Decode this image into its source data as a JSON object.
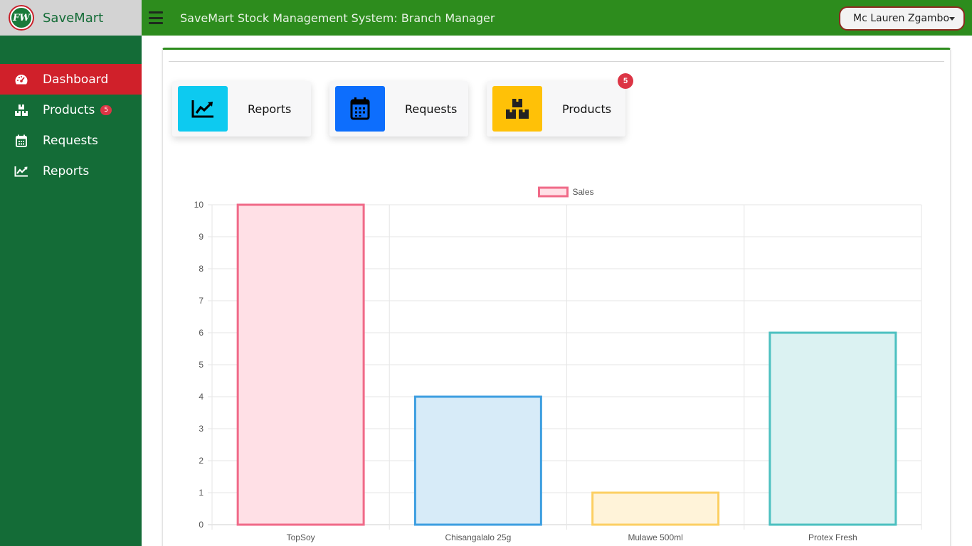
{
  "brand": {
    "name": "SaveMart",
    "logo_text": "FW"
  },
  "sidebar": {
    "items": [
      {
        "label": "Dashboard",
        "icon": "dashboard-icon",
        "active": true
      },
      {
        "label": "Products",
        "icon": "boxes-icon",
        "badge": "5"
      },
      {
        "label": "Requests",
        "icon": "calendar-icon"
      },
      {
        "label": "Reports",
        "icon": "chart-line-icon"
      }
    ]
  },
  "topbar": {
    "title": "SaveMart Stock Management System: Branch Manager",
    "user": "Mc Lauren Zgambo"
  },
  "tiles": [
    {
      "label": "Reports",
      "icon": "chart-line-icon",
      "color": "#0dcaf0"
    },
    {
      "label": "Requests",
      "icon": "calendar-icon",
      "color": "#0d6efd"
    },
    {
      "label": "Products",
      "icon": "boxes-icon",
      "color": "#ffc107",
      "badge": "5"
    }
  ],
  "colors": {
    "sidebar": "#146c37",
    "topbar": "#2d8c1d",
    "active": "#d0202a",
    "badge": "#dc3545"
  },
  "chart_data": {
    "type": "bar",
    "categories": [
      "TopSoy",
      "Chisangalalo 25g",
      "Mulawe 500ml",
      "Protex Fresh"
    ],
    "series": [
      {
        "name": "Sales",
        "values": [
          10,
          4,
          1,
          6
        ]
      }
    ],
    "bar_colors": [
      {
        "fill": "#ffe0e6",
        "stroke": "#f06a88"
      },
      {
        "fill": "#d7ebf8",
        "stroke": "#3c9ee0"
      },
      {
        "fill": "#fff3d9",
        "stroke": "#fccf63"
      },
      {
        "fill": "#dbf2f2",
        "stroke": "#4bc0c0"
      }
    ],
    "legend_swatch": {
      "fill": "#ffe0e6",
      "stroke": "#f06a88"
    },
    "ylim": [
      0,
      10
    ],
    "yticks": [
      "0",
      "1",
      "2",
      "3",
      "4",
      "5",
      "6",
      "7",
      "8",
      "9",
      "10"
    ],
    "grid": true,
    "legend": "top-center"
  }
}
